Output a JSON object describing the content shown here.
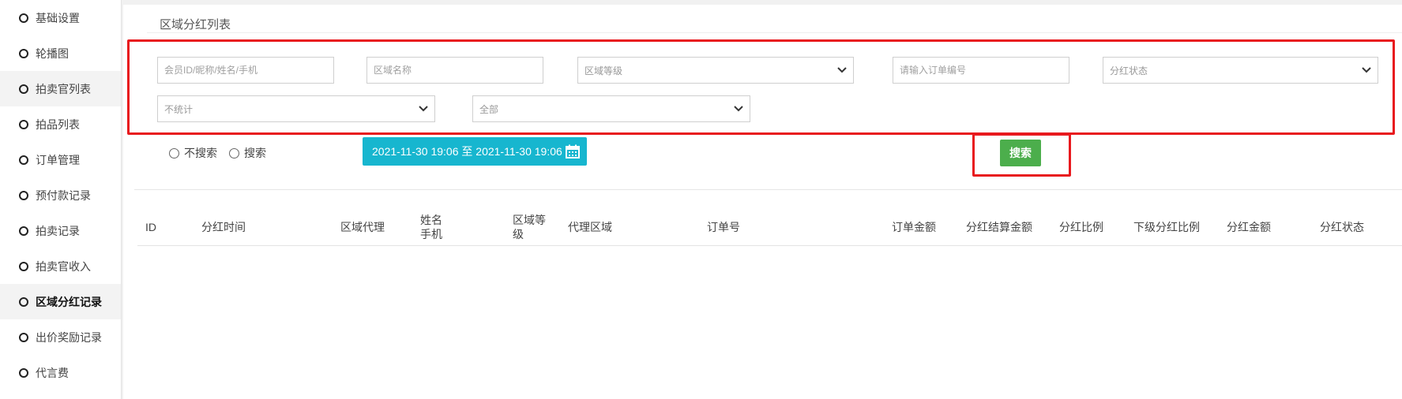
{
  "sidebar": {
    "items": [
      {
        "label": "基础设置"
      },
      {
        "label": "轮播图"
      },
      {
        "label": "拍卖官列表"
      },
      {
        "label": "拍品列表"
      },
      {
        "label": "订单管理"
      },
      {
        "label": "预付款记录"
      },
      {
        "label": "拍卖记录"
      },
      {
        "label": "拍卖官收入"
      },
      {
        "label": "区域分红记录"
      },
      {
        "label": "出价奖励记录"
      },
      {
        "label": "代言费"
      }
    ],
    "active_index": 8
  },
  "page": {
    "title": "区域分红列表"
  },
  "filters": {
    "member_placeholder": "会员ID/昵称/姓名/手机",
    "area_name_placeholder": "区域名称",
    "area_level_selected": "区域等级",
    "order_no_placeholder": "请输入订单编号",
    "dividend_status_selected": "分红状态",
    "stat_selected": "不统计",
    "scope_selected": "全部"
  },
  "time_filter": {
    "radio_no_search": "不搜索",
    "radio_search": "搜索",
    "date_range": "2021-11-30 19:06 至 2021-11-30 19:06"
  },
  "actions": {
    "search_label": "搜索"
  },
  "table": {
    "columns": {
      "id": "ID",
      "dividend_time": "分红时间",
      "area_agent": "区域代理",
      "name": "姓名",
      "phone": "手机",
      "area_level_l1": "区域等",
      "area_level_l2": "级",
      "agent_area": "代理区域",
      "order_no": "订单号",
      "order_amount": "订单金额",
      "settle_amount": "分红结算金额",
      "ratio": "分红比例",
      "sub_ratio": "下级分红比例",
      "dividend_amount": "分红金额",
      "status": "分红状态"
    }
  },
  "colors": {
    "highlight_red": "#e8191e",
    "date_button": "#17b6cf",
    "search_button": "#4cae4c"
  }
}
